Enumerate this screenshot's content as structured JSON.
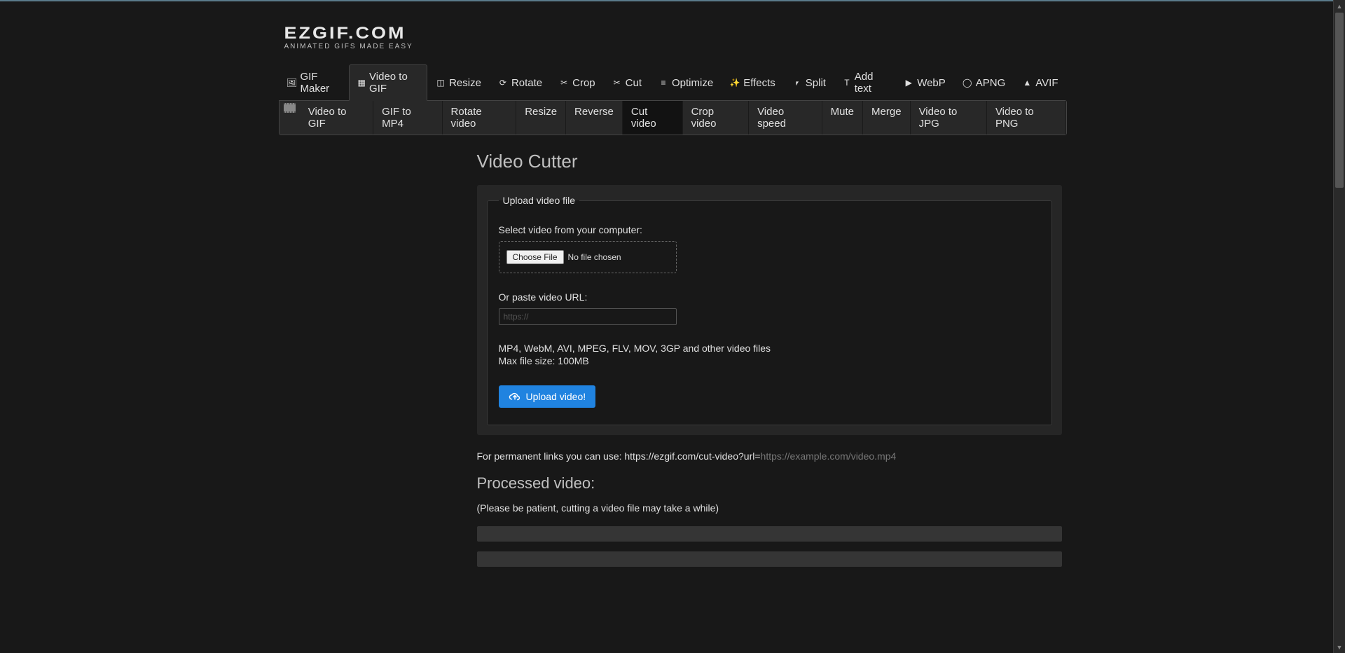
{
  "logo": {
    "main": "EZGIF.COM",
    "sub": "ANIMATED GIFS MADE EASY"
  },
  "nav_primary": [
    {
      "label": "GIF Maker",
      "icon": "🖼",
      "active": false
    },
    {
      "label": "Video to GIF",
      "icon": "▦",
      "active": true
    },
    {
      "label": "Resize",
      "icon": "◫",
      "active": false
    },
    {
      "label": "Rotate",
      "icon": "⟳",
      "active": false
    },
    {
      "label": "Crop",
      "icon": "✂",
      "active": false
    },
    {
      "label": "Cut",
      "icon": "✂",
      "active": false
    },
    {
      "label": "Optimize",
      "icon": "≡",
      "active": false
    },
    {
      "label": "Effects",
      "icon": "✨",
      "active": false
    },
    {
      "label": "Split",
      "icon": "⎖",
      "active": false
    },
    {
      "label": "Add text",
      "icon": "T",
      "active": false
    },
    {
      "label": "WebP",
      "icon": "▶",
      "active": false
    },
    {
      "label": "APNG",
      "icon": "◯",
      "active": false
    },
    {
      "label": "AVIF",
      "icon": "▲",
      "active": false
    }
  ],
  "nav_secondary": [
    {
      "label": "Video to GIF",
      "active": false
    },
    {
      "label": "GIF to MP4",
      "active": false
    },
    {
      "label": "Rotate video",
      "active": false
    },
    {
      "label": "Resize",
      "active": false
    },
    {
      "label": "Reverse",
      "active": false
    },
    {
      "label": "Cut video",
      "active": true
    },
    {
      "label": "Crop video",
      "active": false
    },
    {
      "label": "Video speed",
      "active": false
    },
    {
      "label": "Mute",
      "active": false
    },
    {
      "label": "Merge",
      "active": false
    },
    {
      "label": "Video to JPG",
      "active": false
    },
    {
      "label": "Video to PNG",
      "active": false
    }
  ],
  "page_title": "Video Cutter",
  "upload": {
    "legend": "Upload video file",
    "select_label": "Select video from your computer:",
    "choose": "Choose File",
    "no_file": "No file chosen",
    "url_label": "Or paste video URL:",
    "url_placeholder": "https://",
    "hint_formats": "MP4, WebM, AVI, MPEG, FLV, MOV, 3GP and other video files",
    "hint_size": "Max file size: 100MB",
    "button": "Upload video!"
  },
  "permalink_pre": "For permanent links you can use: https://ezgif.com/cut-video?url=",
  "permalink_ex": "https://example.com/video.mp4",
  "processed_heading": "Processed video:",
  "patience": "(Please be patient, cutting a video file may take a while)"
}
